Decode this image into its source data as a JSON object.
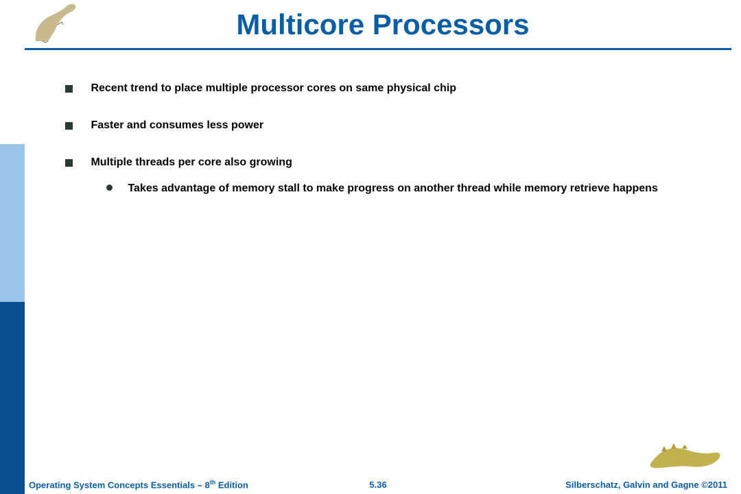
{
  "title": "Multicore Processors",
  "bullets": [
    {
      "text": "Recent trend to place multiple processor cores on same physical chip"
    },
    {
      "text": "Faster and consumes less power"
    },
    {
      "text": "Multiple threads per core also growing",
      "sub": [
        {
          "text": "Takes advantage of memory stall to make progress on another thread while memory retrieve happens"
        }
      ]
    }
  ],
  "footer": {
    "left_prefix": "Operating System Concepts Essentials – 8",
    "left_sup": "th",
    "left_suffix": " Edition",
    "center": "5.36",
    "right": "Silberschatz, Galvin and Gagne ©2011"
  },
  "decor": {
    "top_logo": "dinosaur-upright",
    "bottom_logo": "dinosaur-lying"
  }
}
